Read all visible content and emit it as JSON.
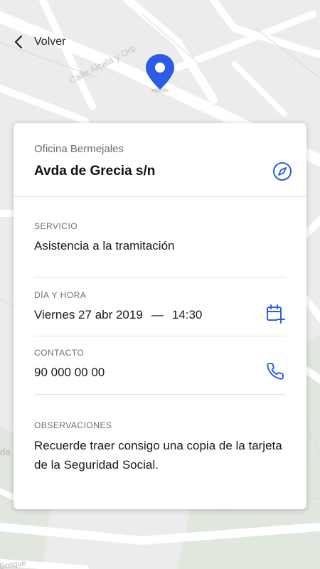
{
  "header": {
    "back_label": "Volver"
  },
  "map": {
    "street_names": [
      "Calle Alcalá y Orti",
      "da",
      "Bosque"
    ],
    "colors": {
      "background": "#ebebeb",
      "road": "#ffffff",
      "park": "#dfe7dc",
      "pin": "#2b5ce6"
    }
  },
  "card": {
    "office_name": "Oficina Bermejales",
    "address": "Avda de Grecia s/n",
    "service": {
      "label": "SERVICIO",
      "value": "Asistencia a la tramitación"
    },
    "datetime": {
      "label": "DÍA Y HORA",
      "date": "Viernes 27 abr 2019",
      "separator": "—",
      "time": "14:30"
    },
    "contact": {
      "label": "CONTACTO",
      "phone": "90 000 00 00"
    },
    "notes": {
      "label": "OBSERVACIONES",
      "text": "Recuerde traer consigo una copia de la tarjeta de la Seguridad Social."
    }
  },
  "icons": [
    "chevron-left-icon",
    "map-pin-icon",
    "compass-icon",
    "calendar-add-icon",
    "phone-icon"
  ],
  "accent_color": "#2b5ce6"
}
